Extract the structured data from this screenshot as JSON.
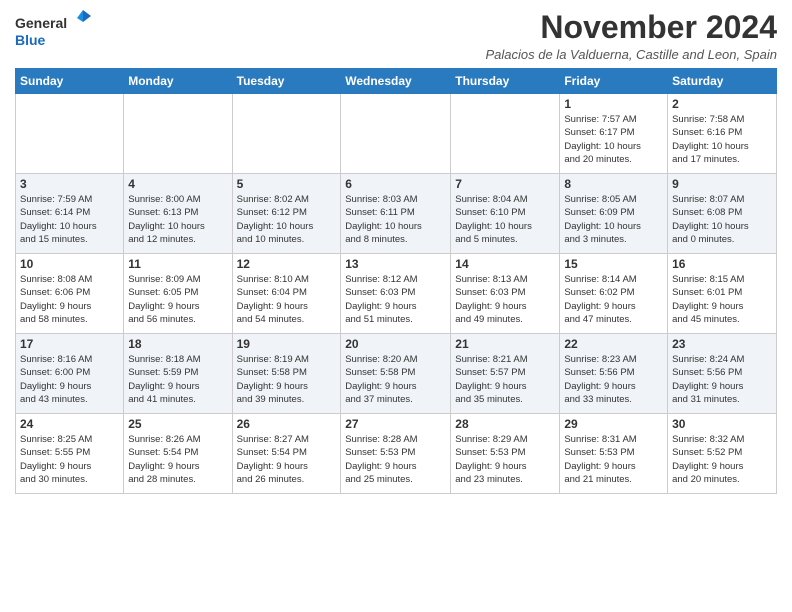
{
  "header": {
    "logo_general": "General",
    "logo_blue": "Blue",
    "month": "November 2024",
    "location": "Palacios de la Valduerna, Castille and Leon, Spain"
  },
  "weekdays": [
    "Sunday",
    "Monday",
    "Tuesday",
    "Wednesday",
    "Thursday",
    "Friday",
    "Saturday"
  ],
  "weeks": [
    [
      {
        "day": "",
        "info": ""
      },
      {
        "day": "",
        "info": ""
      },
      {
        "day": "",
        "info": ""
      },
      {
        "day": "",
        "info": ""
      },
      {
        "day": "",
        "info": ""
      },
      {
        "day": "1",
        "info": "Sunrise: 7:57 AM\nSunset: 6:17 PM\nDaylight: 10 hours\nand 20 minutes."
      },
      {
        "day": "2",
        "info": "Sunrise: 7:58 AM\nSunset: 6:16 PM\nDaylight: 10 hours\nand 17 minutes."
      }
    ],
    [
      {
        "day": "3",
        "info": "Sunrise: 7:59 AM\nSunset: 6:14 PM\nDaylight: 10 hours\nand 15 minutes."
      },
      {
        "day": "4",
        "info": "Sunrise: 8:00 AM\nSunset: 6:13 PM\nDaylight: 10 hours\nand 12 minutes."
      },
      {
        "day": "5",
        "info": "Sunrise: 8:02 AM\nSunset: 6:12 PM\nDaylight: 10 hours\nand 10 minutes."
      },
      {
        "day": "6",
        "info": "Sunrise: 8:03 AM\nSunset: 6:11 PM\nDaylight: 10 hours\nand 8 minutes."
      },
      {
        "day": "7",
        "info": "Sunrise: 8:04 AM\nSunset: 6:10 PM\nDaylight: 10 hours\nand 5 minutes."
      },
      {
        "day": "8",
        "info": "Sunrise: 8:05 AM\nSunset: 6:09 PM\nDaylight: 10 hours\nand 3 minutes."
      },
      {
        "day": "9",
        "info": "Sunrise: 8:07 AM\nSunset: 6:08 PM\nDaylight: 10 hours\nand 0 minutes."
      }
    ],
    [
      {
        "day": "10",
        "info": "Sunrise: 8:08 AM\nSunset: 6:06 PM\nDaylight: 9 hours\nand 58 minutes."
      },
      {
        "day": "11",
        "info": "Sunrise: 8:09 AM\nSunset: 6:05 PM\nDaylight: 9 hours\nand 56 minutes."
      },
      {
        "day": "12",
        "info": "Sunrise: 8:10 AM\nSunset: 6:04 PM\nDaylight: 9 hours\nand 54 minutes."
      },
      {
        "day": "13",
        "info": "Sunrise: 8:12 AM\nSunset: 6:03 PM\nDaylight: 9 hours\nand 51 minutes."
      },
      {
        "day": "14",
        "info": "Sunrise: 8:13 AM\nSunset: 6:03 PM\nDaylight: 9 hours\nand 49 minutes."
      },
      {
        "day": "15",
        "info": "Sunrise: 8:14 AM\nSunset: 6:02 PM\nDaylight: 9 hours\nand 47 minutes."
      },
      {
        "day": "16",
        "info": "Sunrise: 8:15 AM\nSunset: 6:01 PM\nDaylight: 9 hours\nand 45 minutes."
      }
    ],
    [
      {
        "day": "17",
        "info": "Sunrise: 8:16 AM\nSunset: 6:00 PM\nDaylight: 9 hours\nand 43 minutes."
      },
      {
        "day": "18",
        "info": "Sunrise: 8:18 AM\nSunset: 5:59 PM\nDaylight: 9 hours\nand 41 minutes."
      },
      {
        "day": "19",
        "info": "Sunrise: 8:19 AM\nSunset: 5:58 PM\nDaylight: 9 hours\nand 39 minutes."
      },
      {
        "day": "20",
        "info": "Sunrise: 8:20 AM\nSunset: 5:58 PM\nDaylight: 9 hours\nand 37 minutes."
      },
      {
        "day": "21",
        "info": "Sunrise: 8:21 AM\nSunset: 5:57 PM\nDaylight: 9 hours\nand 35 minutes."
      },
      {
        "day": "22",
        "info": "Sunrise: 8:23 AM\nSunset: 5:56 PM\nDaylight: 9 hours\nand 33 minutes."
      },
      {
        "day": "23",
        "info": "Sunrise: 8:24 AM\nSunset: 5:56 PM\nDaylight: 9 hours\nand 31 minutes."
      }
    ],
    [
      {
        "day": "24",
        "info": "Sunrise: 8:25 AM\nSunset: 5:55 PM\nDaylight: 9 hours\nand 30 minutes."
      },
      {
        "day": "25",
        "info": "Sunrise: 8:26 AM\nSunset: 5:54 PM\nDaylight: 9 hours\nand 28 minutes."
      },
      {
        "day": "26",
        "info": "Sunrise: 8:27 AM\nSunset: 5:54 PM\nDaylight: 9 hours\nand 26 minutes."
      },
      {
        "day": "27",
        "info": "Sunrise: 8:28 AM\nSunset: 5:53 PM\nDaylight: 9 hours\nand 25 minutes."
      },
      {
        "day": "28",
        "info": "Sunrise: 8:29 AM\nSunset: 5:53 PM\nDaylight: 9 hours\nand 23 minutes."
      },
      {
        "day": "29",
        "info": "Sunrise: 8:31 AM\nSunset: 5:53 PM\nDaylight: 9 hours\nand 21 minutes."
      },
      {
        "day": "30",
        "info": "Sunrise: 8:32 AM\nSunset: 5:52 PM\nDaylight: 9 hours\nand 20 minutes."
      }
    ]
  ]
}
